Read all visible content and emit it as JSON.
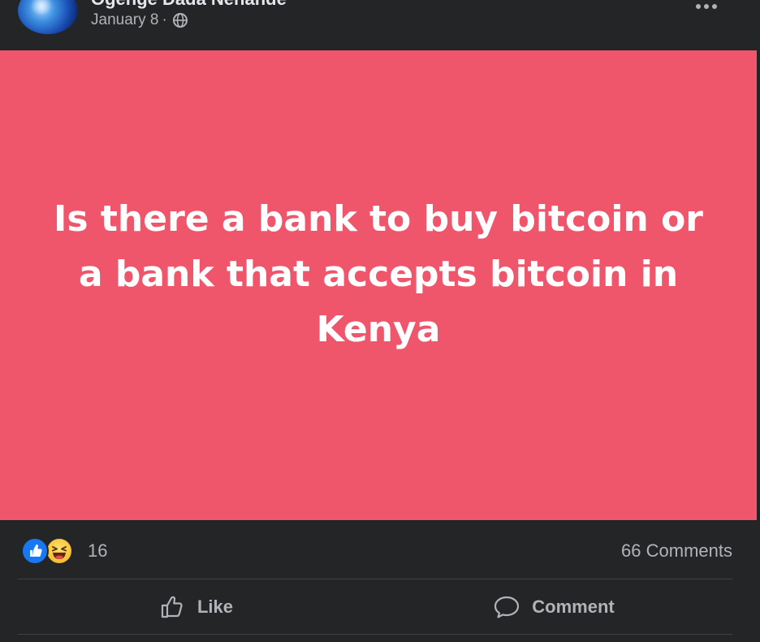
{
  "post": {
    "author": "Ogenge Dada Nehande",
    "date": "January 8",
    "separator": "·",
    "privacy_icon": "globe-icon",
    "more_icon": "more-icon",
    "background_color": "#f0566b",
    "text": "Is there a bank to buy bitcoin or a bank that accepts bitcoin in Kenya"
  },
  "stats": {
    "reactions": [
      "like",
      "haha"
    ],
    "reaction_count": "16",
    "comments_label": "66 Comments"
  },
  "actions": {
    "like_label": "Like",
    "comment_label": "Comment"
  },
  "colors": {
    "page_bg": "#242526",
    "post_bg": "#f0566b",
    "secondary_text": "#b0b3b8",
    "like_blue": "#1877f2"
  }
}
